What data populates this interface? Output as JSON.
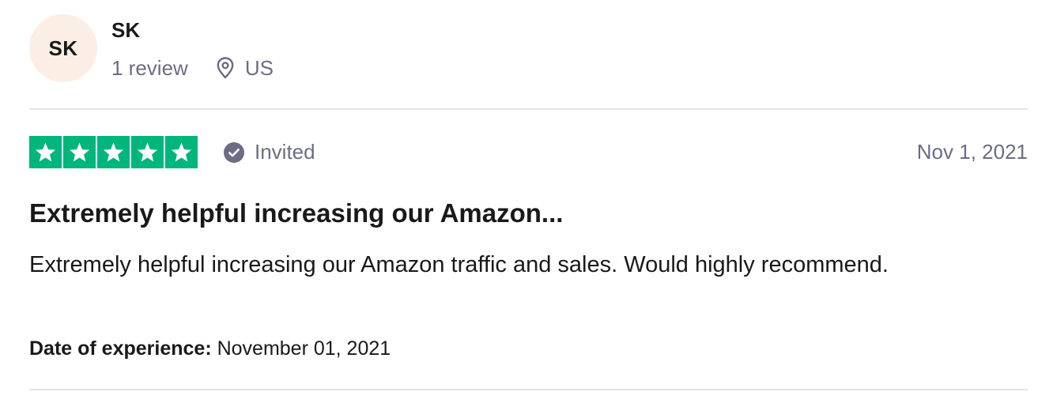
{
  "consumer": {
    "initials": "SK",
    "name": "SK",
    "review_count": "1 review",
    "country": "US",
    "avatar_color": "#fbeee5"
  },
  "review": {
    "rating": 5,
    "max_rating": 5,
    "star_color": "#00b67a",
    "verification_label": "Invited",
    "date": "Nov 1, 2021",
    "title": "Extremely helpful increasing our Amazon...",
    "body": "Extremely helpful increasing our Amazon traffic and sales. Would highly recommend.",
    "experience_label": "Date of experience:",
    "experience_date": "November 01, 2021"
  },
  "icons": {
    "location": "location-pin-icon",
    "verified": "check-circle-icon",
    "star": "star-icon"
  }
}
